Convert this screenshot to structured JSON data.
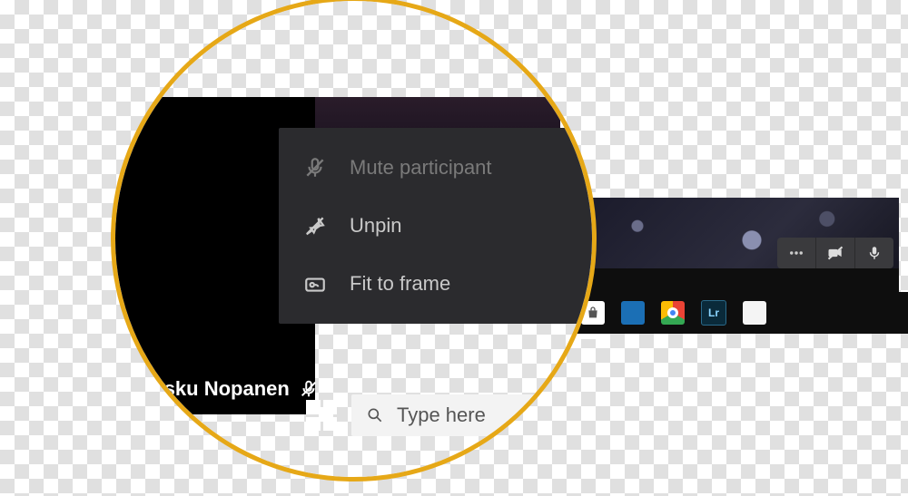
{
  "context_menu": {
    "items": [
      {
        "label": "Mute participant",
        "icon": "mic-off-icon",
        "enabled": false
      },
      {
        "label": "Unpin",
        "icon": "unpin-icon",
        "enabled": true
      },
      {
        "label": "Fit to frame",
        "icon": "frame-icon",
        "enabled": true
      }
    ]
  },
  "participant": {
    "name": "Vesku Nopanen",
    "mic_muted": true
  },
  "search": {
    "placeholder": "Type here"
  },
  "meeting_toolbar": {
    "buttons": [
      "more",
      "camera-off",
      "mic"
    ]
  },
  "taskbar_apps": [
    "store",
    "generic",
    "chrome",
    "lightroom",
    "page"
  ],
  "colors": {
    "magnifier_ring": "#e6a817",
    "menu_bg": "#2b2b2e"
  }
}
